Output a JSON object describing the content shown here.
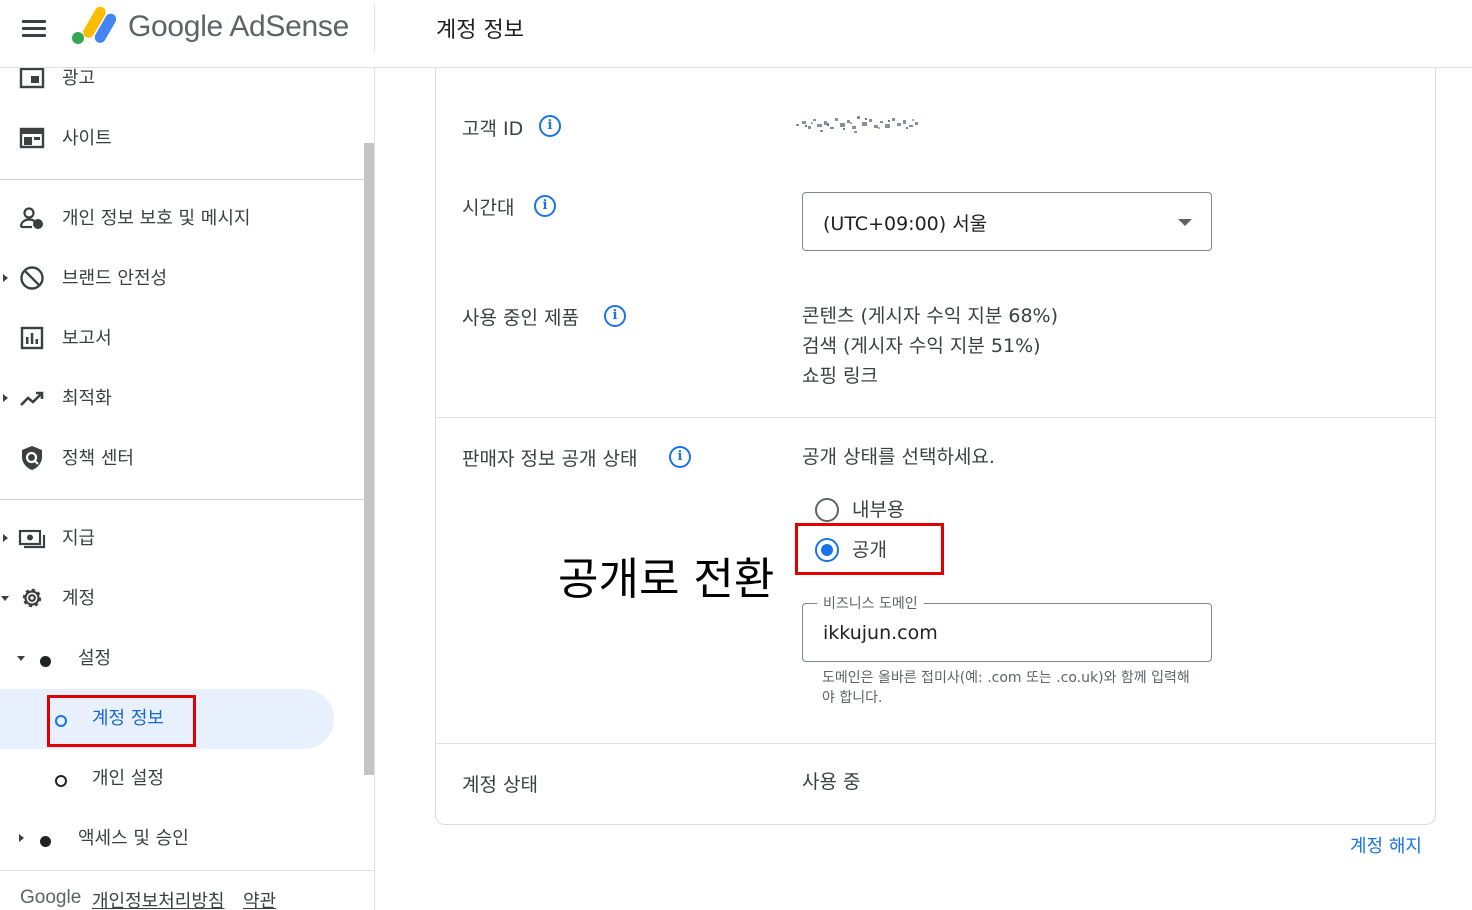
{
  "header": {
    "brand": "Google AdSense",
    "page_title": "계정 정보"
  },
  "sidebar": {
    "items": [
      {
        "label": "광고",
        "icon": "ad-unit-icon"
      },
      {
        "label": "사이트",
        "icon": "site-icon"
      },
      {
        "label": "개인 정보 보호 및 메시지",
        "icon": "privacy-person-icon"
      },
      {
        "label": "브랜드 안전성",
        "icon": "block-icon"
      },
      {
        "label": "보고서",
        "icon": "bar-chart-icon"
      },
      {
        "label": "최적화",
        "icon": "trending-up-icon"
      },
      {
        "label": "정책 센터",
        "icon": "policy-shield-icon"
      },
      {
        "label": "지급",
        "icon": "payments-icon"
      },
      {
        "label": "계정",
        "icon": "gear-icon"
      },
      {
        "label": "설정"
      },
      {
        "label": "계정 정보"
      },
      {
        "label": "개인 설정"
      },
      {
        "label": "액세스 및 승인"
      }
    ],
    "footer": {
      "google": "Google",
      "privacy": "개인정보처리방침",
      "terms": "약관"
    }
  },
  "account": {
    "customer_id_label": "고객 ID",
    "timezone_label": "시간대",
    "timezone_value": "(UTC+09:00) 서울",
    "products_label": "사용 중인 제품",
    "products": [
      "콘텐츠 (게시자 수익 지분 68%)",
      "검색 (게시자 수익 지분 51%)",
      "쇼핑 링크"
    ],
    "seller_label": "판매자 정보 공개 상태",
    "seller_prompt": "공개 상태를 선택하세요.",
    "radio_internal": "내부용",
    "radio_public": "공개",
    "selected": "공개",
    "domain_label": "비즈니스 도메인",
    "domain_value": "ikkujun.com",
    "domain_helper": "도메인은 올바른 접미사(예: .com 또는 .co.uk)와 함께 입력해야 합니다.",
    "status_label": "계정 상태",
    "status_value": "사용 중",
    "close_account": "계정 해지"
  },
  "annotation": "공개로 전환",
  "colors": {
    "accent": "#1a73e8",
    "highlight_box": "#e00000",
    "active_nav_bg": "#e8f0fe"
  }
}
